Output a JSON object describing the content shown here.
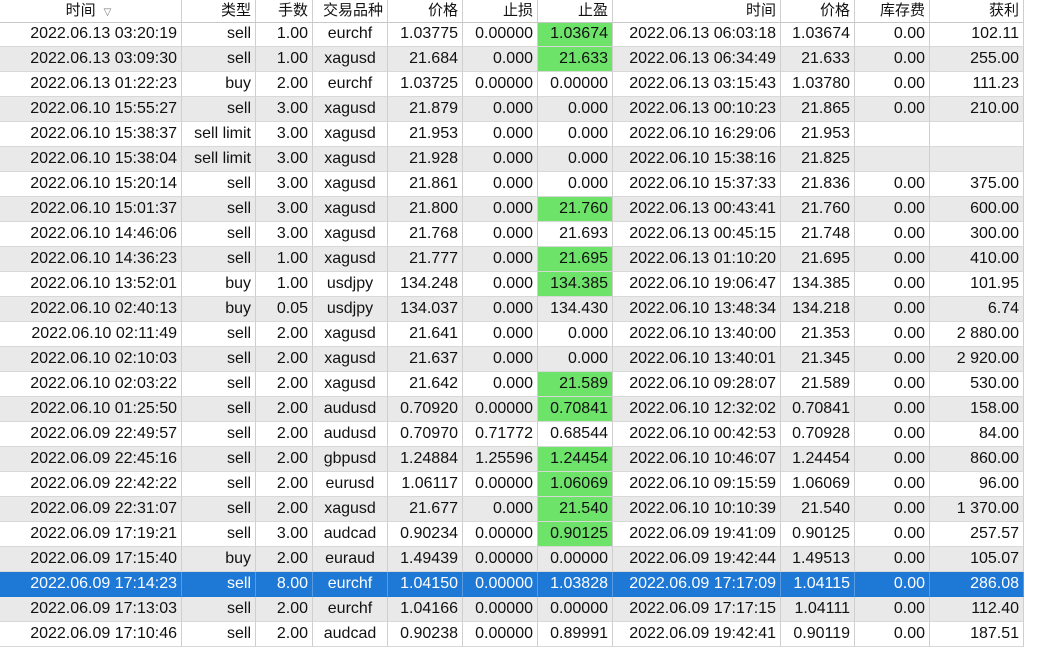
{
  "columns": [
    "时间",
    "类型",
    "手数",
    "交易品种",
    "价格",
    "止损",
    "止盈",
    "时间",
    "价格",
    "库存费",
    "获利"
  ],
  "sort_icon": "sort-descending-icon",
  "colors": {
    "tp_hit": "#6de36a",
    "selected_row": "#1e78d6",
    "alt_row": "#e9e9e9"
  },
  "selected_row_index": 22,
  "rows": [
    {
      "cells": [
        "2022.06.13 03:20:19",
        "sell",
        "1.00",
        "eurchf",
        "1.03775",
        "0.00000",
        "1.03674",
        "2022.06.13 06:03:18",
        "1.03674",
        "0.00",
        "102.11"
      ],
      "tp_hit": true
    },
    {
      "cells": [
        "2022.06.13 03:09:30",
        "sell",
        "1.00",
        "xagusd",
        "21.684",
        "0.000",
        "21.633",
        "2022.06.13 06:34:49",
        "21.633",
        "0.00",
        "255.00"
      ],
      "tp_hit": true
    },
    {
      "cells": [
        "2022.06.13 01:22:23",
        "buy",
        "2.00",
        "eurchf",
        "1.03725",
        "0.00000",
        "0.00000",
        "2022.06.13 03:15:43",
        "1.03780",
        "0.00",
        "111.23"
      ],
      "tp_hit": false
    },
    {
      "cells": [
        "2022.06.10 15:55:27",
        "sell",
        "3.00",
        "xagusd",
        "21.879",
        "0.000",
        "0.000",
        "2022.06.13 00:10:23",
        "21.865",
        "0.00",
        "210.00"
      ],
      "tp_hit": false
    },
    {
      "cells": [
        "2022.06.10 15:38:37",
        "sell limit",
        "3.00",
        "xagusd",
        "21.953",
        "0.000",
        "0.000",
        "2022.06.10 16:29:06",
        "21.953",
        "",
        ""
      ],
      "tp_hit": false
    },
    {
      "cells": [
        "2022.06.10 15:38:04",
        "sell limit",
        "3.00",
        "xagusd",
        "21.928",
        "0.000",
        "0.000",
        "2022.06.10 15:38:16",
        "21.825",
        "",
        ""
      ],
      "tp_hit": false
    },
    {
      "cells": [
        "2022.06.10 15:20:14",
        "sell",
        "3.00",
        "xagusd",
        "21.861",
        "0.000",
        "0.000",
        "2022.06.10 15:37:33",
        "21.836",
        "0.00",
        "375.00"
      ],
      "tp_hit": false
    },
    {
      "cells": [
        "2022.06.10 15:01:37",
        "sell",
        "3.00",
        "xagusd",
        "21.800",
        "0.000",
        "21.760",
        "2022.06.13 00:43:41",
        "21.760",
        "0.00",
        "600.00"
      ],
      "tp_hit": true
    },
    {
      "cells": [
        "2022.06.10 14:46:06",
        "sell",
        "3.00",
        "xagusd",
        "21.768",
        "0.000",
        "21.693",
        "2022.06.13 00:45:15",
        "21.748",
        "0.00",
        "300.00"
      ],
      "tp_hit": false
    },
    {
      "cells": [
        "2022.06.10 14:36:23",
        "sell",
        "1.00",
        "xagusd",
        "21.777",
        "0.000",
        "21.695",
        "2022.06.13 01:10:20",
        "21.695",
        "0.00",
        "410.00"
      ],
      "tp_hit": true
    },
    {
      "cells": [
        "2022.06.10 13:52:01",
        "buy",
        "1.00",
        "usdjpy",
        "134.248",
        "0.000",
        "134.385",
        "2022.06.10 19:06:47",
        "134.385",
        "0.00",
        "101.95"
      ],
      "tp_hit": true
    },
    {
      "cells": [
        "2022.06.10 02:40:13",
        "buy",
        "0.05",
        "usdjpy",
        "134.037",
        "0.000",
        "134.430",
        "2022.06.10 13:48:34",
        "134.218",
        "0.00",
        "6.74"
      ],
      "tp_hit": false
    },
    {
      "cells": [
        "2022.06.10 02:11:49",
        "sell",
        "2.00",
        "xagusd",
        "21.641",
        "0.000",
        "0.000",
        "2022.06.10 13:40:00",
        "21.353",
        "0.00",
        "2 880.00"
      ],
      "tp_hit": false
    },
    {
      "cells": [
        "2022.06.10 02:10:03",
        "sell",
        "2.00",
        "xagusd",
        "21.637",
        "0.000",
        "0.000",
        "2022.06.10 13:40:01",
        "21.345",
        "0.00",
        "2 920.00"
      ],
      "tp_hit": false
    },
    {
      "cells": [
        "2022.06.10 02:03:22",
        "sell",
        "2.00",
        "xagusd",
        "21.642",
        "0.000",
        "21.589",
        "2022.06.10 09:28:07",
        "21.589",
        "0.00",
        "530.00"
      ],
      "tp_hit": true
    },
    {
      "cells": [
        "2022.06.10 01:25:50",
        "sell",
        "2.00",
        "audusd",
        "0.70920",
        "0.00000",
        "0.70841",
        "2022.06.10 12:32:02",
        "0.70841",
        "0.00",
        "158.00"
      ],
      "tp_hit": true
    },
    {
      "cells": [
        "2022.06.09 22:49:57",
        "sell",
        "2.00",
        "audusd",
        "0.70970",
        "0.71772",
        "0.68544",
        "2022.06.10 00:42:53",
        "0.70928",
        "0.00",
        "84.00"
      ],
      "tp_hit": false
    },
    {
      "cells": [
        "2022.06.09 22:45:16",
        "sell",
        "2.00",
        "gbpusd",
        "1.24884",
        "1.25596",
        "1.24454",
        "2022.06.10 10:46:07",
        "1.24454",
        "0.00",
        "860.00"
      ],
      "tp_hit": true
    },
    {
      "cells": [
        "2022.06.09 22:42:22",
        "sell",
        "2.00",
        "eurusd",
        "1.06117",
        "0.00000",
        "1.06069",
        "2022.06.10 09:15:59",
        "1.06069",
        "0.00",
        "96.00"
      ],
      "tp_hit": true
    },
    {
      "cells": [
        "2022.06.09 22:31:07",
        "sell",
        "2.00",
        "xagusd",
        "21.677",
        "0.000",
        "21.540",
        "2022.06.10 10:10:39",
        "21.540",
        "0.00",
        "1 370.00"
      ],
      "tp_hit": true
    },
    {
      "cells": [
        "2022.06.09 17:19:21",
        "sell",
        "3.00",
        "audcad",
        "0.90234",
        "0.00000",
        "0.90125",
        "2022.06.09 19:41:09",
        "0.90125",
        "0.00",
        "257.57"
      ],
      "tp_hit": true
    },
    {
      "cells": [
        "2022.06.09 17:15:40",
        "buy",
        "2.00",
        "euraud",
        "1.49439",
        "0.00000",
        "0.00000",
        "2022.06.09 19:42:44",
        "1.49513",
        "0.00",
        "105.07"
      ],
      "tp_hit": false
    },
    {
      "cells": [
        "2022.06.09 17:14:23",
        "sell",
        "8.00",
        "eurchf",
        "1.04150",
        "0.00000",
        "1.03828",
        "2022.06.09 17:17:09",
        "1.04115",
        "0.00",
        "286.08"
      ],
      "tp_hit": false
    },
    {
      "cells": [
        "2022.06.09 17:13:03",
        "sell",
        "2.00",
        "eurchf",
        "1.04166",
        "0.00000",
        "0.00000",
        "2022.06.09 17:17:15",
        "1.04111",
        "0.00",
        "112.40"
      ],
      "tp_hit": false
    },
    {
      "cells": [
        "2022.06.09 17:10:46",
        "sell",
        "2.00",
        "audcad",
        "0.90238",
        "0.00000",
        "0.89991",
        "2022.06.09 19:42:41",
        "0.90119",
        "0.00",
        "187.51"
      ],
      "tp_hit": false
    }
  ]
}
